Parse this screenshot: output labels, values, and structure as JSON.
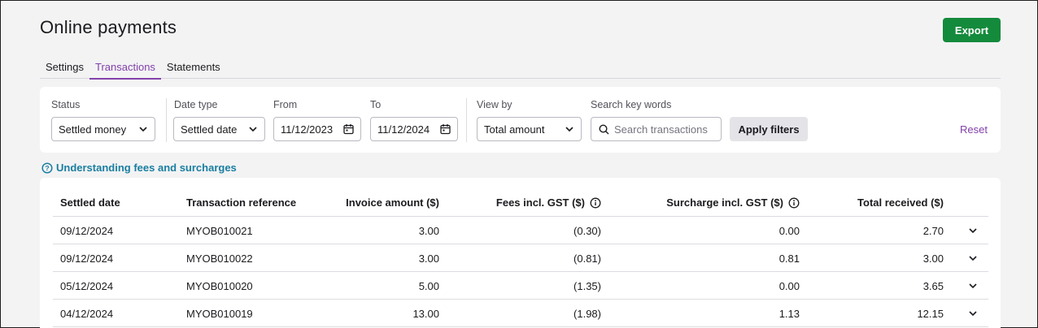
{
  "header": {
    "title": "Online payments",
    "export_label": "Export"
  },
  "tabs": [
    {
      "label": "Settings",
      "active": false
    },
    {
      "label": "Transactions",
      "active": true
    },
    {
      "label": "Statements",
      "active": false
    }
  ],
  "filters": {
    "status": {
      "label": "Status",
      "value": "Settled money"
    },
    "date_type": {
      "label": "Date type",
      "value": "Settled date"
    },
    "from": {
      "label": "From",
      "value": "11/12/2023"
    },
    "to": {
      "label": "To",
      "value": "11/12/2024"
    },
    "view_by": {
      "label": "View by",
      "value": "Total amount"
    },
    "search": {
      "label": "Search key words",
      "placeholder": "Search transactions"
    },
    "apply_label": "Apply filters",
    "reset_label": "Reset"
  },
  "info_link": "Understanding fees and surcharges",
  "table": {
    "columns": [
      "Settled date",
      "Transaction reference",
      "Invoice amount ($)",
      "Fees incl. GST ($)",
      "Surcharge incl. GST ($)",
      "Total received ($)"
    ],
    "rows": [
      [
        "09/12/2024",
        "MYOB010021",
        "3.00",
        "(0.30)",
        "0.00",
        "2.70"
      ],
      [
        "09/12/2024",
        "MYOB010022",
        "3.00",
        "(0.81)",
        "0.81",
        "3.00"
      ],
      [
        "05/12/2024",
        "MYOB010020",
        "5.00",
        "(1.35)",
        "0.00",
        "3.65"
      ],
      [
        "04/12/2024",
        "MYOB010019",
        "13.00",
        "(1.98)",
        "1.13",
        "12.15"
      ]
    ]
  },
  "colors": {
    "accent": "#8241aa",
    "primary_button": "#148a3c",
    "link": "#1a7ea0"
  },
  "icons": [
    "chevron-down-icon",
    "calendar-icon",
    "search-icon",
    "info-icon",
    "help-circle-icon"
  ]
}
